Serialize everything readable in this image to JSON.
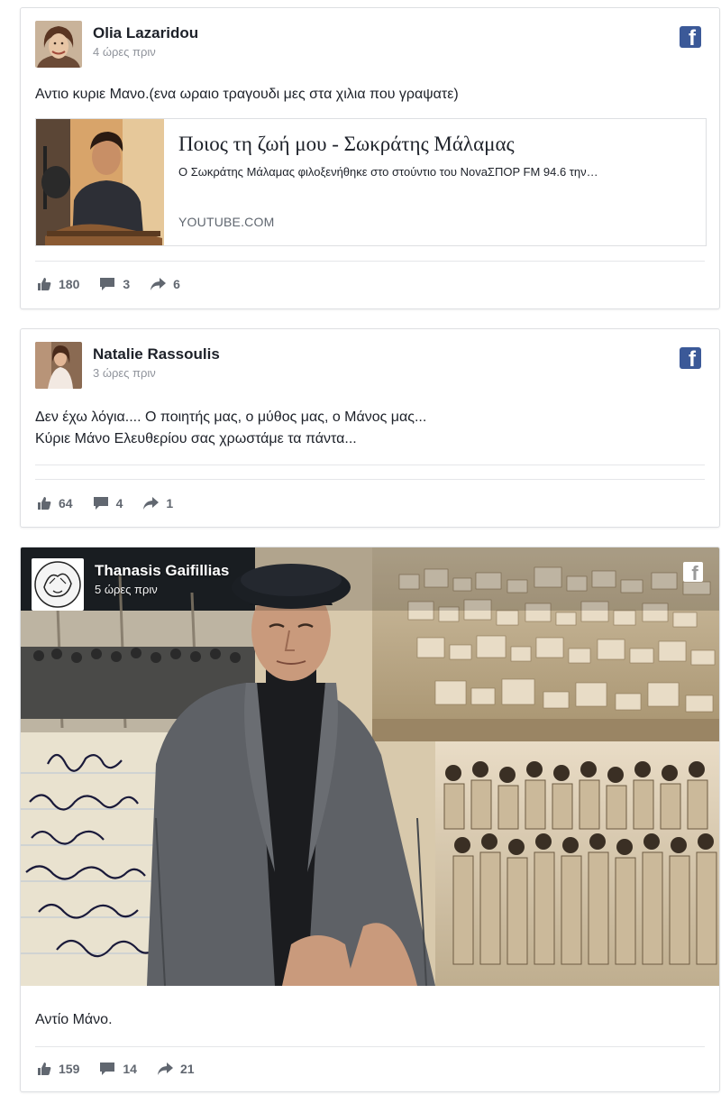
{
  "posts": [
    {
      "author": "Olia Lazaridou",
      "time": "4 ώρες πριν",
      "text": "Αντιο κυριε Μανο.(ενα ωραιο τραγουδι μες στα χιλια που γραψατε)",
      "link": {
        "title": "Ποιος τη ζωή μου - Σωκράτης Μάλαμας",
        "description": "Ο Σωκράτης Μάλαμας φιλοξενήθηκε στο στούντιο του NovaΣΠΟΡ FM 94.6 την…",
        "domain": "YOUTUBE.COM"
      },
      "likes": "180",
      "comments": "3",
      "shares": "6"
    },
    {
      "author": "Natalie Rassoulis",
      "time": "3 ώρες πριν",
      "text_line1": "Δεν έχω λόγια.... Ο ποιητής μας, ο μύθος μας, ο Μάνος μας...",
      "text_line2": "Κύριε Μάνο Ελευθερίου σας χρωστάμε τα πάντα...",
      "likes": "64",
      "comments": "4",
      "shares": "1"
    },
    {
      "author": "Thanasis Gaifillias",
      "time": "5 ώρες πριν",
      "text": "Αντίο Μάνο.",
      "likes": "159",
      "comments": "14",
      "shares": "21"
    }
  ],
  "icons": {
    "like": "thumbs-up-icon",
    "comment": "comment-icon",
    "share": "share-arrow-icon",
    "facebook": "facebook-logo-icon"
  },
  "colors": {
    "facebook_blue": "#3b5998",
    "stat_grey": "#616770"
  }
}
